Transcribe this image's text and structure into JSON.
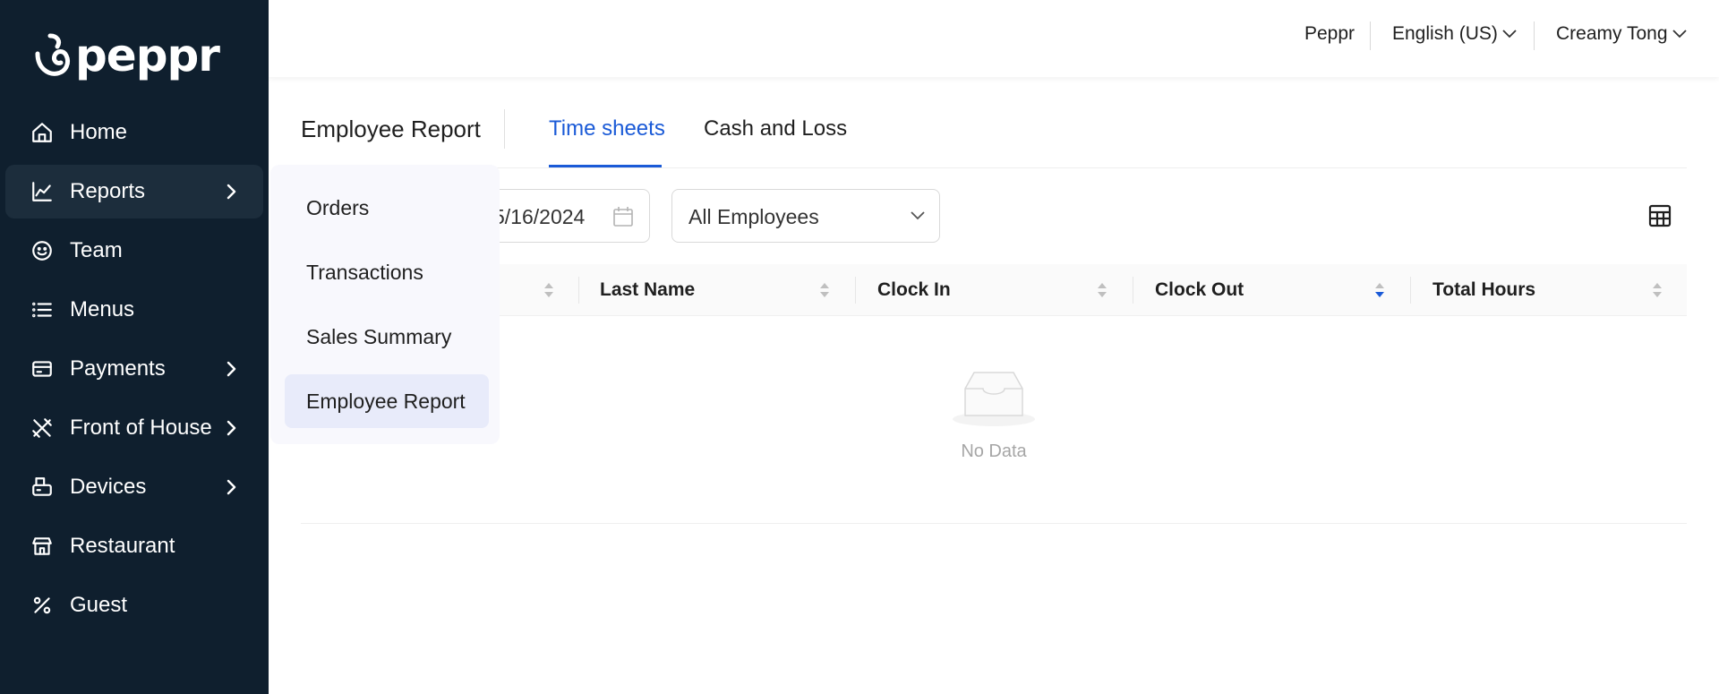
{
  "brand": {
    "name": "peppr"
  },
  "header": {
    "org": "Peppr",
    "language": "English (US)",
    "user": "Creamy Tong"
  },
  "sidebar": {
    "items": [
      {
        "label": "Home",
        "icon": "home-icon",
        "has_children": false
      },
      {
        "label": "Reports",
        "icon": "chart-line-icon",
        "has_children": true
      },
      {
        "label": "Team",
        "icon": "smile-icon",
        "has_children": false
      },
      {
        "label": "Menus",
        "icon": "list-icon",
        "has_children": false
      },
      {
        "label": "Payments",
        "icon": "credit-card-icon",
        "has_children": true
      },
      {
        "label": "Front of House",
        "icon": "utensils-icon",
        "has_children": true
      },
      {
        "label": "Devices",
        "icon": "pos-terminal-icon",
        "has_children": true
      },
      {
        "label": "Restaurant",
        "icon": "store-icon",
        "has_children": false
      },
      {
        "label": "Guest",
        "icon": "percent-icon",
        "has_children": false
      }
    ]
  },
  "reports_submenu": {
    "items": [
      "Orders",
      "Transactions",
      "Sales Summary",
      "Employee Report"
    ],
    "selected": "Employee Report"
  },
  "page": {
    "title": "Employee Report",
    "tabs": [
      "Time sheets",
      "Cash and Loss"
    ],
    "active_tab": "Time sheets"
  },
  "filters": {
    "date_visible_text": "5/16/2024",
    "employee_select": "All Employees"
  },
  "table": {
    "columns": [
      "Last Name",
      "Clock In",
      "Clock Out",
      "Total Hours"
    ],
    "sorted_column": "Clock Out",
    "sort_direction": "descending",
    "empty_text": "No Data"
  },
  "colors": {
    "sidebar_bg": "#0f1f2e",
    "accent": "#1a5ad7",
    "submenu_bg": "#f8f8fd",
    "submenu_selected_bg": "#e8ebfa"
  }
}
